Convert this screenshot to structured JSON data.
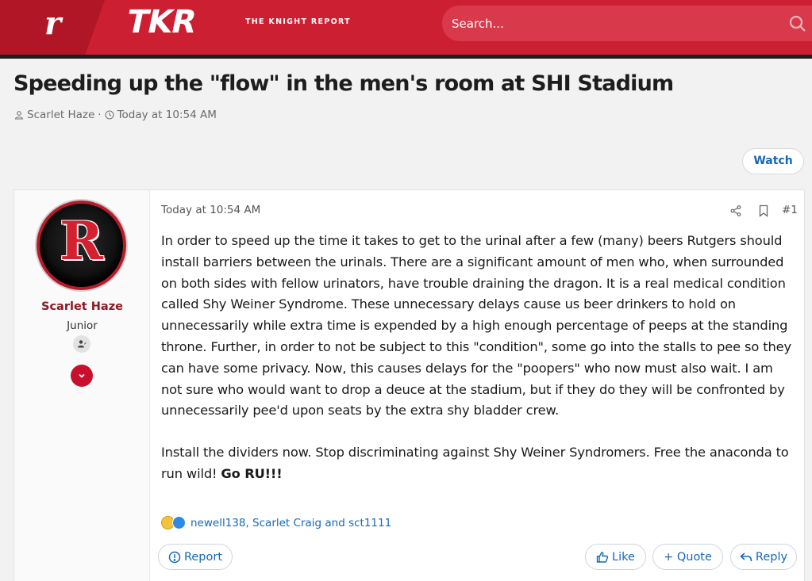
{
  "header": {
    "logo_letter": "r",
    "brand": "TKR",
    "brand_sub": "THE KNIGHT REPORT",
    "search_placeholder": "Search..."
  },
  "thread": {
    "title": "Speeding up the \"flow\" in the men's room at SHI Stadium",
    "author": "Scarlet Haze",
    "separator": "·",
    "date": "Today at 10:54 AM",
    "watch_label": "Watch"
  },
  "post": {
    "user": {
      "name": "Scarlet Haze",
      "rank": "Junior",
      "avatar_letter": "R"
    },
    "date": "Today at 10:54 AM",
    "number": "#1",
    "paragraph1": "In order to speed up the time it takes to get to the urinal after a few (many) beers Rutgers should install barriers between the urinals. There are a significant amount of men who, when surrounded on both sides with fellow urinators, have trouble draining the dragon. It is a real medical condition called Shy Weiner Syndrome. These unnecessary delays cause us beer drinkers to hold on unnecessarily while extra time is expended by a high enough percentage of peeps at the standing throne. Further, in order to not be subject to this \"condition\", some go into the stalls to pee so they can have some privacy. Now, this causes delays for the \"poopers\" who now must also wait. I am not sure who would want to drop a deuce at the stadium, but if they do they will be confronted by unnecessarily pee'd upon seats by the extra shy bladder crew.",
    "paragraph2": "Install the dividers now. Stop discriminating against Shy Weiner Syndromers. Free the anaconda to run wild!",
    "paragraph2_bold": "Go RU!!!",
    "reactions_text": "newell138, Scarlet Craig and sct1111",
    "report_label": "Report",
    "like_label": "Like",
    "quote_label": "+ Quote",
    "reply_label": "Reply"
  },
  "colors": {
    "header_red": "#cc1f32",
    "link_blue": "#1468b8",
    "username_red": "#8b1a24"
  }
}
